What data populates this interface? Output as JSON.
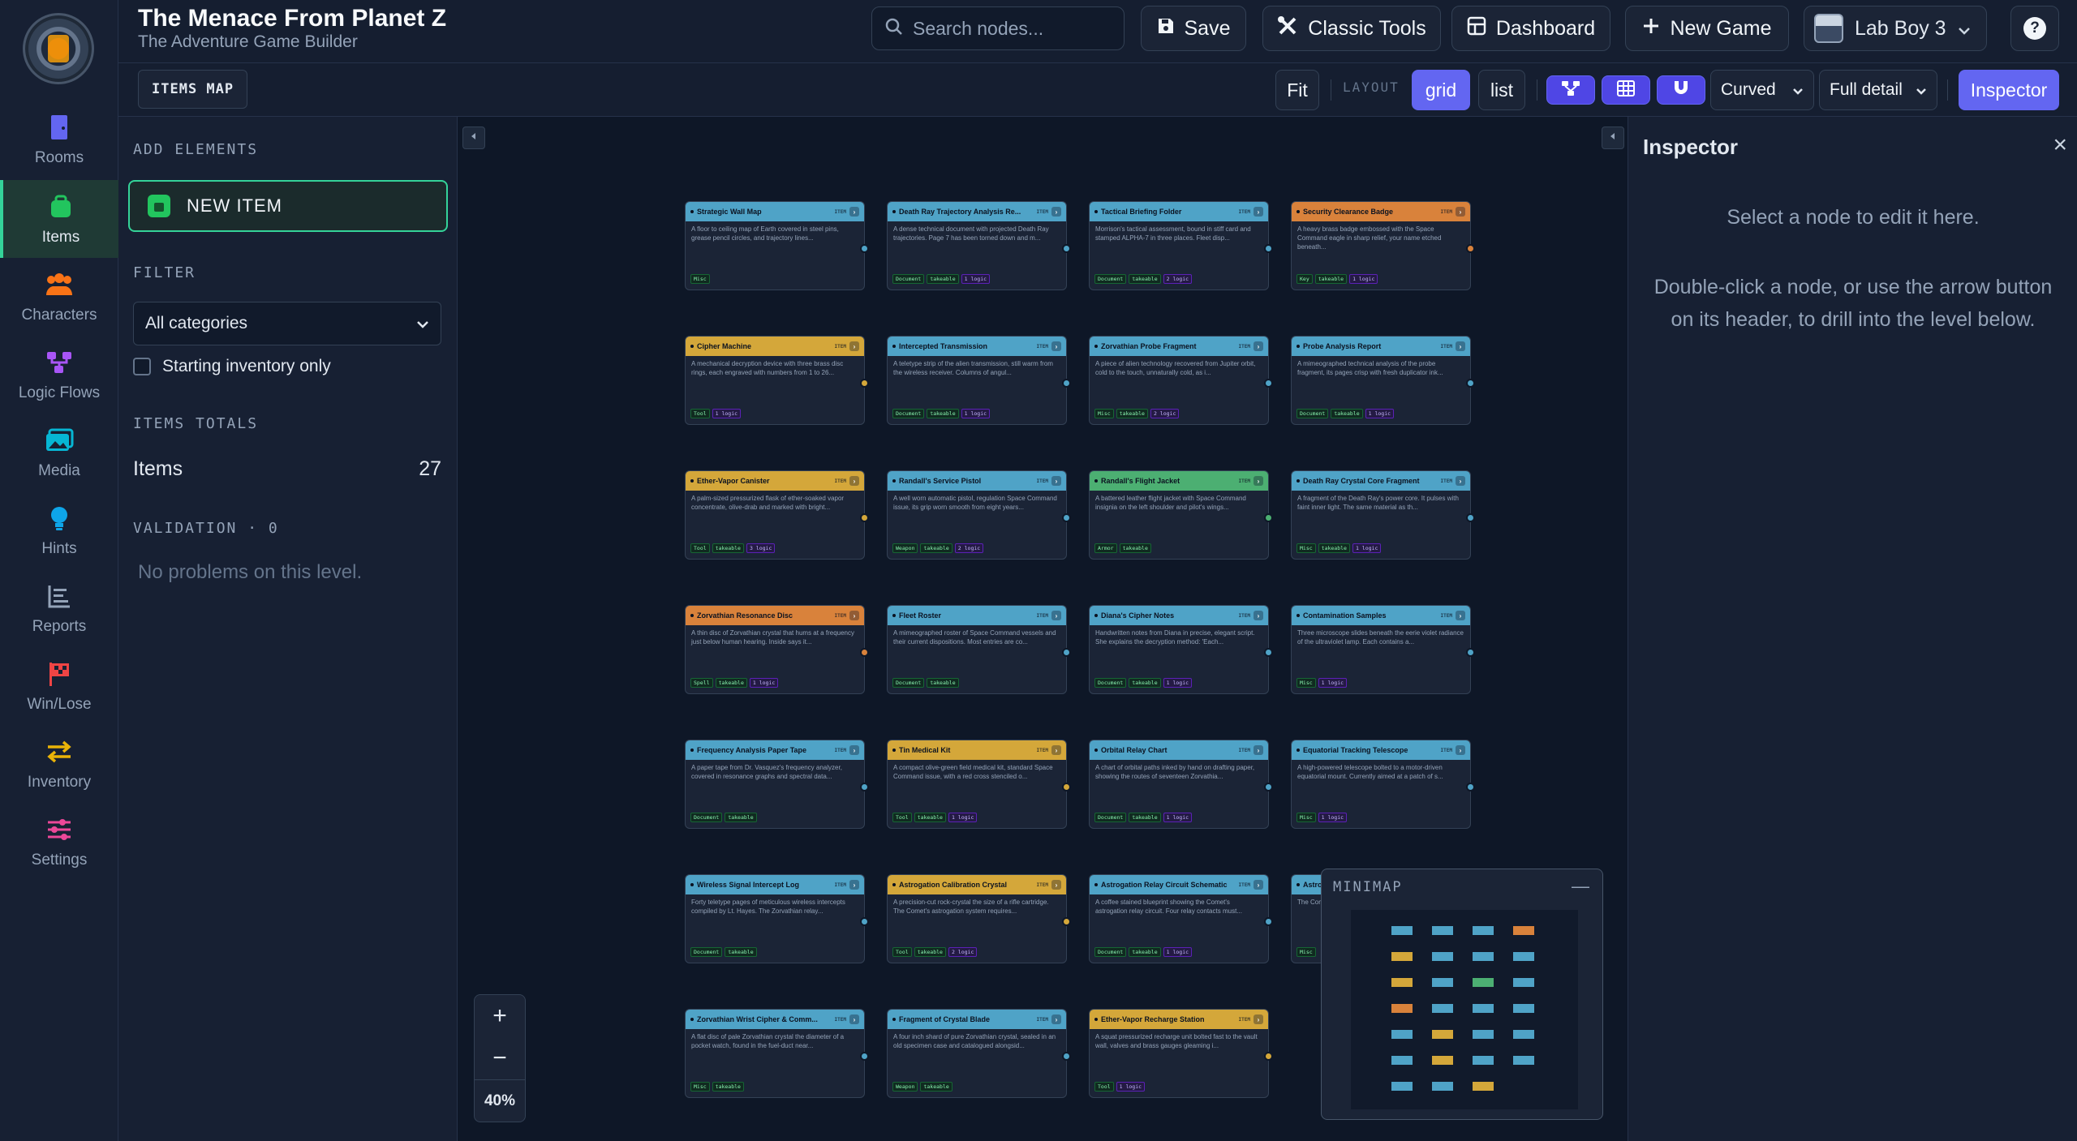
{
  "app": {
    "title": "The Menace From Planet Z",
    "subtitle": "The Adventure Game Builder"
  },
  "header": {
    "search_placeholder": "Search nodes...",
    "save_label": "Save",
    "classic_tools_label": "Classic Tools",
    "dashboard_label": "Dashboard",
    "new_game_label": "New Game",
    "user_name": "Lab Boy 3",
    "help_label": "?"
  },
  "nav": {
    "items": [
      {
        "label": "Rooms",
        "icon": "door-icon",
        "color": "#6366f1"
      },
      {
        "label": "Items",
        "icon": "bag-icon",
        "color": "#22c55e",
        "active": true
      },
      {
        "label": "Characters",
        "icon": "people-icon",
        "color": "#f97316"
      },
      {
        "label": "Logic Flows",
        "icon": "flow-icon",
        "color": "#a855f7"
      },
      {
        "label": "Media",
        "icon": "image-icon",
        "color": "#06b6d4"
      },
      {
        "label": "Hints",
        "icon": "lightbulb-icon",
        "color": "#0ea5e9"
      },
      {
        "label": "Reports",
        "icon": "report-icon",
        "color": "#94a3b8"
      },
      {
        "label": "Win/Lose",
        "icon": "flag-icon",
        "color": "#ef4444"
      },
      {
        "label": "Inventory",
        "icon": "swap-icon",
        "color": "#eab308"
      },
      {
        "label": "Settings",
        "icon": "sliders-icon",
        "color": "#ec4899"
      }
    ]
  },
  "toolbar": {
    "map_label": "ITEMS MAP",
    "fit_label": "Fit",
    "layout_label": "LAYOUT",
    "grid_label": "grid",
    "list_label": "list",
    "edge_style": "Curved",
    "detail_level": "Full detail",
    "inspector_label": "Inspector"
  },
  "sidepanel": {
    "add_heading": "ADD ELEMENTS",
    "new_item_label": "NEW ITEM",
    "filter_heading": "FILTER",
    "category_value": "All categories",
    "starting_inventory_label": "Starting inventory only",
    "totals_heading": "ITEMS TOTALS",
    "totals_label": "Items",
    "totals_value": "27",
    "validation_heading": "VALIDATION · 0",
    "validation_message": "No problems on this level."
  },
  "canvas": {
    "zoom_in": "+",
    "zoom_out": "−",
    "zoom_level": "40%",
    "minimap_title": "MINIMAP",
    "minimap_minimize": "—",
    "type_label": "ITEM",
    "colors": {
      "blue": "#4fa3c7",
      "yellow": "#d4a73a",
      "green": "#4caf72",
      "orange": "#d9823b"
    },
    "nodes": [
      {
        "title": "Strategic Wall Map",
        "color": "blue",
        "desc": "A floor to ceiling map of Earth covered in steel pins, grease pencil circles, and trajectory lines...",
        "tags": [
          "Misc"
        ]
      },
      {
        "title": "Death Ray Trajectory Analysis Re...",
        "color": "blue",
        "desc": "A dense technical document with projected Death Ray trajectories. Page 7 has been torned down and m...",
        "tags": [
          "Document",
          "takeable",
          "1 logic"
        ]
      },
      {
        "title": "Tactical Briefing Folder",
        "color": "blue",
        "desc": "Morrison's tactical assessment, bound in stiff card and stamped ALPHA-7 in three places. Fleet disp...",
        "tags": [
          "Document",
          "takeable",
          "2 logic"
        ]
      },
      {
        "title": "Security Clearance Badge",
        "color": "orange",
        "desc": "A heavy brass badge embossed with the Space Command eagle in sharp relief, your name etched beneath...",
        "tags": [
          "Key",
          "takeable",
          "1 logic"
        ]
      },
      {
        "title": "Cipher Machine",
        "color": "yellow",
        "desc": "A mechanical decryption device with three brass disc rings, each engraved with numbers from 1 to 26...",
        "tags": [
          "Tool",
          "1 logic"
        ]
      },
      {
        "title": "Intercepted Transmission",
        "color": "blue",
        "desc": "A teletype strip of the alien transmission, still warm from the wireless receiver. Columns of angul...",
        "tags": [
          "Document",
          "takeable",
          "1 logic"
        ]
      },
      {
        "title": "Zorvathian Probe Fragment",
        "color": "blue",
        "desc": "A piece of alien technology recovered from Jupiter orbit, cold to the touch, unnaturally cold, as i...",
        "tags": [
          "Misc",
          "takeable",
          "2 logic"
        ]
      },
      {
        "title": "Probe Analysis Report",
        "color": "blue",
        "desc": "A mimeographed technical analysis of the probe fragment, its pages crisp with fresh duplicator ink...",
        "tags": [
          "Document",
          "takeable",
          "1 logic"
        ]
      },
      {
        "title": "Ether-Vapor Canister",
        "color": "yellow",
        "desc": "A palm-sized pressurized flask of ether-soaked vapor concentrate, olive-drab and marked with bright...",
        "tags": [
          "Tool",
          "takeable",
          "3 logic"
        ]
      },
      {
        "title": "Randall's Service Pistol",
        "color": "blue",
        "desc": "A well worn automatic pistol, regulation Space Command issue, its grip worn smooth from eight years...",
        "tags": [
          "Weapon",
          "takeable",
          "2 logic"
        ]
      },
      {
        "title": "Randall's Flight Jacket",
        "color": "green",
        "desc": "A battered leather flight jacket with Space Command insignia on the left shoulder and pilot's wings...",
        "tags": [
          "Armor",
          "takeable"
        ]
      },
      {
        "title": "Death Ray Crystal Core Fragment",
        "color": "blue",
        "desc": "A fragment of the Death Ray's power core. It pulses with faint inner light. The same material as th...",
        "tags": [
          "Misc",
          "takeable",
          "1 logic"
        ]
      },
      {
        "title": "Zorvathian Resonance Disc",
        "color": "orange",
        "desc": "A thin disc of Zorvathian crystal that hums at a frequency just below human hearing. Inside says it...",
        "tags": [
          "Spell",
          "takeable",
          "1 logic"
        ]
      },
      {
        "title": "Fleet Roster",
        "color": "blue",
        "desc": "A mimeographed roster of Space Command vessels and their current dispositions. Most entries are co...",
        "tags": [
          "Document",
          "takeable"
        ]
      },
      {
        "title": "Diana's Cipher Notes",
        "color": "blue",
        "desc": "Handwritten notes from Diana in precise, elegant script. She explains the decryption method: 'Each...",
        "tags": [
          "Document",
          "takeable",
          "1 logic"
        ]
      },
      {
        "title": "Contamination Samples",
        "color": "blue",
        "desc": "Three microscope slides beneath the eerie violet radiance of the ultraviolet lamp. Each contains a...",
        "tags": [
          "Misc",
          "1 logic"
        ]
      },
      {
        "title": "Frequency Analysis Paper Tape",
        "color": "blue",
        "desc": "A paper tape from Dr. Vasquez's frequency analyzer, covered in resonance graphs and spectral data...",
        "tags": [
          "Document",
          "takeable"
        ]
      },
      {
        "title": "Tin Medical Kit",
        "color": "yellow",
        "desc": "A compact olive-green field medical kit, standard Space Command issue, with a red cross stenciled o...",
        "tags": [
          "Tool",
          "takeable",
          "1 logic"
        ]
      },
      {
        "title": "Orbital Relay Chart",
        "color": "blue",
        "desc": "A chart of orbital paths inked by hand on drafting paper, showing the routes of seventeen Zorvathia...",
        "tags": [
          "Document",
          "takeable",
          "1 logic"
        ]
      },
      {
        "title": "Equatorial Tracking Telescope",
        "color": "blue",
        "desc": "A high-powered telescope bolted to a motor-driven equatorial mount. Currently aimed at a patch of s...",
        "tags": [
          "Misc",
          "1 logic"
        ]
      },
      {
        "title": "Wireless Signal Intercept Log",
        "color": "blue",
        "desc": "Forty teletype pages of meticulous wireless intercepts compiled by Lt. Hayes. The Zorvathian relay...",
        "tags": [
          "Document",
          "takeable"
        ]
      },
      {
        "title": "Astrogation Calibration Crystal",
        "color": "yellow",
        "desc": "A precision-cut rock-crystal the size of a rifle cartridge. The Comet's astrogation system requires...",
        "tags": [
          "Tool",
          "takeable",
          "2 logic"
        ]
      },
      {
        "title": "Astrogation Relay Circuit Schematic",
        "color": "blue",
        "desc": "A coffee stained blueprint showing the Comet's astrogation relay circuit. Four relay contacts must...",
        "tags": [
          "Document",
          "takeable",
          "1 logic"
        ]
      },
      {
        "title": "Astrogation Helm",
        "color": "blue",
        "desc": "The Comet's astrogation helm, ship fore...",
        "tags": [
          "Misc"
        ]
      },
      {
        "title": "Zorvathian Wrist Cipher & Comm...",
        "color": "blue",
        "desc": "A flat disc of pale Zorvathian crystal the diameter of a pocket watch, found in the fuel-duct near...",
        "tags": [
          "Misc",
          "takeable"
        ]
      },
      {
        "title": "Fragment of Crystal Blade",
        "color": "blue",
        "desc": "A four inch shard of pure Zorvathian crystal, sealed in an old specimen case and catalogued alongsid...",
        "tags": [
          "Weapon",
          "takeable"
        ]
      },
      {
        "title": "Ether-Vapor Recharge Station",
        "color": "yellow",
        "desc": "A squat pressurized recharge unit bolted fast to the vault wall, valves and brass gauges gleaming i...",
        "tags": [
          "Tool",
          "1 logic"
        ]
      }
    ]
  },
  "inspector": {
    "title": "Inspector",
    "close_label": "×",
    "message_primary": "Select a node to edit it here.",
    "message_secondary": "Double-click a node, or use the arrow button on its header, to drill into the level below."
  }
}
